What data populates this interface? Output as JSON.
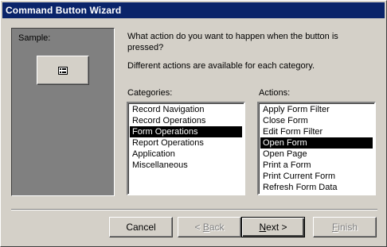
{
  "window": {
    "title": "Command Button Wizard"
  },
  "sample": {
    "label": "Sample:",
    "button_icon": "form-icon"
  },
  "prompt": {
    "line1": "What action do you want to happen when the button is",
    "line2": "pressed?",
    "info": "Different actions are available for each category."
  },
  "categories": {
    "label": "Categories:",
    "items": [
      "Record Navigation",
      "Record Operations",
      "Form Operations",
      "Report Operations",
      "Application",
      "Miscellaneous"
    ],
    "selected": "Form Operations"
  },
  "actions": {
    "label": "Actions:",
    "items": [
      "Apply Form Filter",
      "Close Form",
      "Edit Form Filter",
      "Open Form",
      "Open Page",
      "Print a Form",
      "Print Current Form",
      "Refresh Form Data"
    ],
    "selected": "Open Form"
  },
  "buttons": {
    "cancel": "Cancel",
    "back_pre": "< ",
    "back_ul": "B",
    "back_post": "ack",
    "next_ul": "N",
    "next_post": "ext >",
    "finish_ul": "F",
    "finish_post": "inish"
  },
  "colors": {
    "title_bar": "#0a246a",
    "face": "#d4d0c8",
    "sample_panel": "#808080",
    "selection": "#000000"
  }
}
